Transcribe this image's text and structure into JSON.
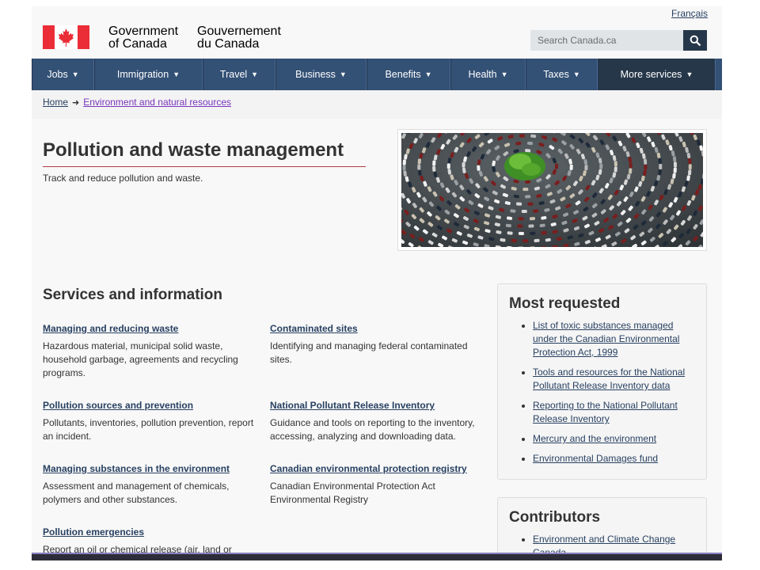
{
  "header": {
    "lang_link": "Français",
    "signature_en": [
      "Government",
      "of Canada"
    ],
    "signature_fr": [
      "Gouvernement",
      "du Canada"
    ],
    "search_placeholder": "Search Canada.ca"
  },
  "nav": {
    "items": [
      {
        "label": "Jobs"
      },
      {
        "label": "Immigration"
      },
      {
        "label": "Travel"
      },
      {
        "label": "Business"
      },
      {
        "label": "Benefits"
      },
      {
        "label": "Health"
      },
      {
        "label": "Taxes"
      },
      {
        "label": "More services"
      }
    ]
  },
  "breadcrumb": {
    "items": [
      "Home",
      "Environment and natural resources"
    ]
  },
  "page": {
    "title": "Pollution and waste management",
    "lead": "Track and reduce pollution and waste."
  },
  "services": {
    "heading": "Services and information",
    "items": [
      {
        "title": "Managing and reducing waste",
        "desc": "Hazardous material, municipal solid waste, household garbage, agreements and recycling programs."
      },
      {
        "title": "Contaminated sites",
        "desc": "Identifying and managing federal contaminated sites."
      },
      {
        "title": "Pollution sources and prevention",
        "desc": "Pollutants, inventories, pollution prevention, report an incident."
      },
      {
        "title": "National Pollutant Release Inventory",
        "desc": "Guidance and tools on reporting to the inventory, accessing, analyzing and downloading data."
      },
      {
        "title": "Managing substances in the environment",
        "desc": "Assessment and management of chemicals, polymers and other substances."
      },
      {
        "title": "Canadian environmental protection registry",
        "desc": "Canadian Environmental Protection Act Environmental Registry"
      },
      {
        "title": "Pollution emergencies",
        "desc": "Report an oil or chemical release (air, land or"
      }
    ]
  },
  "most_requested": {
    "heading": "Most requested",
    "items": [
      "List of toxic substances managed under the Canadian Environmental Protection Act, 1999",
      "Tools and resources for the National Pollutant Release Inventory data",
      "Reporting to the National Pollutant Release Inventory",
      "Mercury and the environment",
      "Environmental Damages fund"
    ]
  },
  "contributors": {
    "heading": "Contributors",
    "items": [
      "Environment and Climate Change Canada"
    ]
  },
  "colors": {
    "nav_bg": "#335075",
    "nav_more_bg": "#26374a",
    "link": "#284162",
    "title_underline": "#af3c43"
  }
}
